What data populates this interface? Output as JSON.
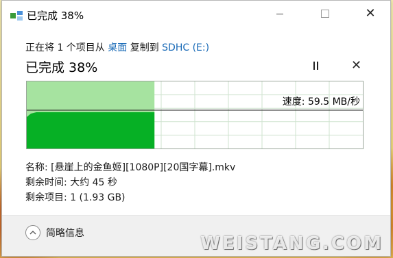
{
  "window": {
    "title": "已完成 38%",
    "controls": {
      "minimize": "minimize",
      "maximize": "maximize",
      "close": "✕"
    }
  },
  "copy": {
    "from_prefix": "正在将 1 个项目从",
    "source": "桌面",
    "to_prefix": "复制到",
    "destination": "SDHC (E:)",
    "headline": "已完成 38%",
    "progress_fraction": 0.38
  },
  "graph": {
    "speed_label": "速度: 59.5 MB/秒"
  },
  "details": {
    "name": "名称: [悬崖上的金鱼姬][1080P][20国字幕].mkv",
    "time_remaining": "剩余时间: 大约 45 秒",
    "items_remaining": "剩余项目: 1 (1.93 GB)"
  },
  "footer": {
    "collapse_label": "简略信息"
  },
  "watermark": "WEISTANG.COM",
  "colors": {
    "progress_light": "#a6e3a0",
    "progress_dark": "#06b025",
    "link": "#1668b6"
  },
  "icons": [
    "copy-files-icon",
    "pause-icon",
    "cancel-icon",
    "chevron-up-icon"
  ]
}
